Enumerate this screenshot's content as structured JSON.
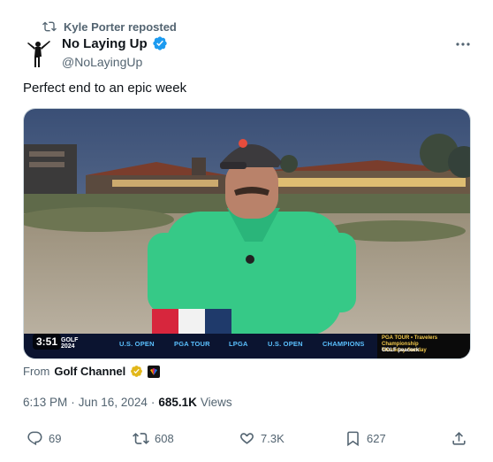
{
  "repost": {
    "label": "Kyle Porter reposted"
  },
  "author": {
    "name": "No Laying Up",
    "handle": "@NoLayingUp"
  },
  "tweet": {
    "text": "Perfect end to an epic week"
  },
  "video": {
    "timecode": "3:51",
    "ticker_logo_line1": "GOLF",
    "ticker_logo_line2": "2024",
    "ticker_items": [
      "U.S. OPEN",
      "PGA TOUR",
      "LPGA",
      "U.S. OPEN",
      "CHAMPIONS"
    ],
    "ticker_right_line1": "PGA TOUR • Travelers Championship",
    "ticker_right_line2": "Thursday-Sunday",
    "ticker_right_line3": "GOLF   peacock"
  },
  "source": {
    "prefix": "From",
    "channel": "Golf Channel"
  },
  "meta": {
    "time": "6:13 PM",
    "separator": "·",
    "date": "Jun 16, 2024",
    "separator2": "·",
    "views_count": "685.1K",
    "views_label": "Views"
  },
  "actions": {
    "replies": "69",
    "reposts": "608",
    "likes": "7.3K",
    "bookmarks": "627"
  },
  "colors": {
    "accent": "#1d9bf0",
    "muted": "#536471",
    "text": "#0f1419",
    "gold": "#e2b719"
  },
  "icons": [
    "repost-icon",
    "verified-icon",
    "more-icon",
    "gold-verified-icon",
    "reply-icon",
    "retweet-icon",
    "like-icon",
    "bookmark-icon",
    "share-icon"
  ]
}
